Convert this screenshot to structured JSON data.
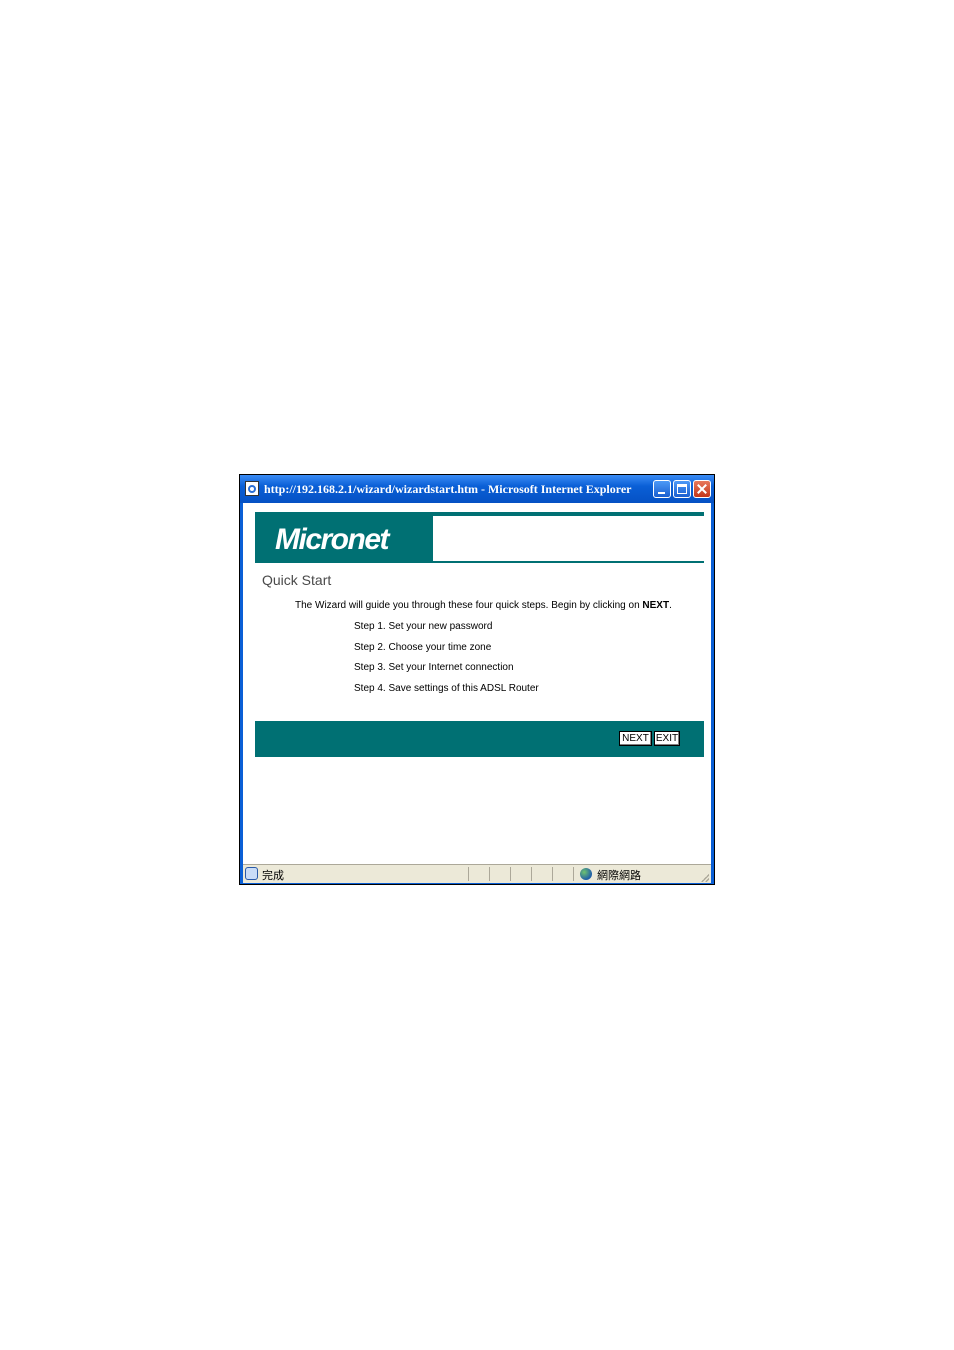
{
  "window": {
    "title": "http://192.168.2.1/wizard/wizardstart.htm - Microsoft Internet Explorer"
  },
  "header": {
    "logo_text": "Micronet"
  },
  "main": {
    "title": "Quick Start",
    "intro_prefix": "The Wizard will guide you through these four quick steps. Begin by clicking on ",
    "intro_emphasis": "NEXT",
    "intro_suffix": ".",
    "steps": [
      "Step 1. Set your new password",
      "Step 2. Choose your time zone",
      "Step 3. Set your Internet connection",
      "Step 4. Save settings of this ADSL Router"
    ]
  },
  "footer": {
    "next_label": "NEXT",
    "exit_label": "EXIT"
  },
  "statusbar": {
    "status_text": "完成",
    "zone_text": "網際網路"
  },
  "colors": {
    "brand_teal": "#007073",
    "titlebar_blue": "#0a5fd6"
  }
}
